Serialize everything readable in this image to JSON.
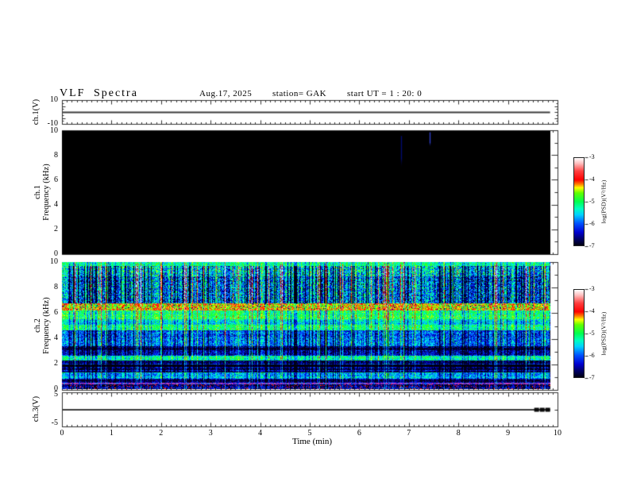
{
  "header": {
    "title": "VLF Spectra",
    "date": "Aug.17, 2025",
    "station": "station= GAK",
    "start_ut": "start UT =  1 : 20: 0"
  },
  "panels": {
    "ch1v": {
      "ylabel": "ch.1(V)",
      "ytick_top": "10",
      "ytick_bottom": "-10"
    },
    "spec1": {
      "ylabel_line1": "ch.1",
      "ylabel_line2": "Frequency (kHz)",
      "yticks": [
        "0",
        "2",
        "4",
        "6",
        "8",
        "10"
      ]
    },
    "spec2": {
      "ylabel_line1": "ch.2",
      "ylabel_line2": "Frequency (kHz)",
      "yticks": [
        "0",
        "2",
        "4",
        "6",
        "8",
        "10"
      ]
    },
    "ch3v": {
      "ylabel": "ch.3(V)",
      "ytick_top": "5",
      "ytick_bottom": "-5"
    }
  },
  "xaxis": {
    "ticks": [
      "0",
      "1",
      "2",
      "3",
      "4",
      "5",
      "6",
      "7",
      "8",
      "9",
      "10"
    ],
    "label": "Time (min)"
  },
  "colorbar": {
    "ticks": [
      "-3",
      "-4",
      "-5",
      "-6",
      "-7"
    ],
    "label": "log(PSD)(V²/Hz)"
  },
  "colors": {
    "frame": "#333333",
    "line": "#3c3c3c",
    "spec1_bg": "#000000"
  },
  "chart_data": [
    {
      "type": "line",
      "panel": "ch.1(V)",
      "xlabel": "Time (min)",
      "x_range_min": [
        0,
        10
      ],
      "y_range_V": [
        -10,
        10
      ],
      "series": [
        {
          "name": "ch.1 voltage",
          "x": [
            0,
            9.85
          ],
          "y": [
            0,
            0
          ],
          "description": "flat line at 0 V for entire record"
        }
      ]
    },
    {
      "type": "heatmap",
      "panel": "ch.1 spectrogram",
      "x_range_min": [
        0,
        10
      ],
      "y_range_khz": [
        0,
        10
      ],
      "z_range_logpsd": [
        -7,
        -3
      ],
      "background_level": -7,
      "features": [
        {
          "kind": "vertical-streak",
          "time_min": 6.85,
          "freq_khz": [
            7.0,
            9.6
          ],
          "color": "#000e8a",
          "alpha": 0.8
        },
        {
          "kind": "vertical-streak",
          "time_min": 7.42,
          "freq_khz": [
            8.7,
            9.9
          ],
          "color": "#2f3fd0",
          "alpha": 0.95
        }
      ]
    },
    {
      "type": "heatmap",
      "panel": "ch.2 spectrogram",
      "x_range_min": [
        0,
        9.85
      ],
      "y_range_khz": [
        0,
        10
      ],
      "z_range_logpsd": [
        -7,
        -3
      ],
      "bands": [
        {
          "f_hi": 10.0,
          "f_lo": 9.7,
          "level": -5.2,
          "noise": 0.5,
          "col_sens": 0.5,
          "row_var": 0.1
        },
        {
          "f_hi": 9.7,
          "f_lo": 8.9,
          "level": -5.6,
          "noise": 0.8,
          "col_sens": 1.4,
          "row_var": 0.15
        },
        {
          "f_hi": 8.9,
          "f_lo": 6.75,
          "level": -5.95,
          "noise": 0.8,
          "col_sens": 1.5,
          "row_var": 0.15
        },
        {
          "f_hi": 6.75,
          "f_lo": 6.2,
          "level": -4.35,
          "noise": 0.5,
          "col_sens": 0.45,
          "row_var": 0.1,
          "spike_hi_p": 0.05,
          "spike_hi_v": -3.5,
          "spike_lo_p": 0.05,
          "spike_lo_v": -6.6
        },
        {
          "f_hi": 6.2,
          "f_lo": 5.55,
          "level": -5.05,
          "noise": 0.5,
          "col_sens": 0.6,
          "row_var": 0.15
        },
        {
          "f_hi": 5.55,
          "f_lo": 5.1,
          "level": -5.5,
          "noise": 0.5,
          "col_sens": 0.65,
          "row_var": 0.15
        },
        {
          "f_hi": 5.1,
          "f_lo": 4.65,
          "level": -5.15,
          "noise": 0.5,
          "col_sens": 0.6,
          "row_var": 0.15
        },
        {
          "f_hi": 4.65,
          "f_lo": 3.4,
          "level": -6.0,
          "noise": 0.55,
          "col_sens": 0.8,
          "row_var": 0.2
        },
        {
          "f_hi": 3.4,
          "f_lo": 2.65,
          "level": -6.35,
          "noise": 0.5,
          "col_sens": 0.7,
          "row_var": 0.3,
          "dark_rows": true
        },
        {
          "f_hi": 2.65,
          "f_lo": 2.3,
          "level": -5.35,
          "noise": 0.5,
          "col_sens": 0.5,
          "row_var": 0.2
        },
        {
          "f_hi": 2.3,
          "f_lo": 1.35,
          "level": -6.55,
          "noise": 0.45,
          "col_sens": 0.6,
          "row_var": 0.35,
          "dark_rows": true
        },
        {
          "f_hi": 1.35,
          "f_lo": 0.85,
          "level": -5.75,
          "noise": 0.5,
          "col_sens": 0.6,
          "row_var": 0.2
        },
        {
          "f_hi": 0.85,
          "f_lo": 0.52,
          "level": -6.7,
          "noise": 0.4,
          "col_sens": 0.45,
          "row_var": 0.2
        },
        {
          "f_hi": 0.52,
          "f_lo": 0.38,
          "level": -6.0,
          "noise": 0.4,
          "col_sens": 0.3,
          "row_var": 0.1,
          "magenta": true
        },
        {
          "f_hi": 0.38,
          "f_lo": 0.0,
          "level": -6.6,
          "noise": 0.5,
          "col_sens": 0.4,
          "row_var": 0.2,
          "spike_hi_p": 0.08,
          "spike_hi_v": -3.9
        }
      ],
      "description": "broadband noisy spectrogram: bright yellow-orange band ~6.2-6.75 kHz, green bands ~4.6-6.2 kHz, blue speckle below, dense vertical green/cyan and dark streaks above 6.75 kHz, magenta line ~0.45 kHz"
    },
    {
      "type": "line",
      "panel": "ch.3(V)",
      "x_range_min": [
        0,
        10
      ],
      "y_range_V": [
        -5,
        5
      ],
      "series": [
        {
          "name": "ch.3 voltage",
          "x": [
            0,
            9.85
          ],
          "y": [
            0,
            0
          ],
          "description": "flat line at 0 V with thick saturated black segment 9.53-9.86 min"
        }
      ],
      "features": [
        {
          "kind": "saturated-segment",
          "time_min": [
            9.53,
            9.86
          ],
          "y_V": 0
        }
      ]
    }
  ],
  "colormap_stops": [
    [
      0.0,
      "#000010"
    ],
    [
      0.08,
      "#000070"
    ],
    [
      0.15,
      "#0000d0"
    ],
    [
      0.25,
      "#0050ff"
    ],
    [
      0.35,
      "#00d0ff"
    ],
    [
      0.42,
      "#00ffc0"
    ],
    [
      0.5,
      "#00ff50"
    ],
    [
      0.6,
      "#60ff00"
    ],
    [
      0.66,
      "#ffff00"
    ],
    [
      0.7,
      "#ff8000"
    ],
    [
      0.75,
      "#ff0000"
    ],
    [
      0.85,
      "#ff4040"
    ],
    [
      0.94,
      "#ffc0c0"
    ],
    [
      1.0,
      "#ffffff"
    ]
  ]
}
